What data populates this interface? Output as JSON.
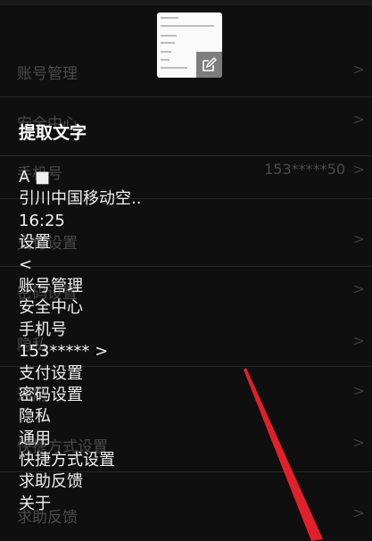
{
  "background": {
    "rows": [
      {
        "label": "账号管理",
        "value": ""
      },
      {
        "label": "安全中心",
        "value": ""
      },
      {
        "label": "手机号",
        "value": "153*****50"
      },
      {
        "label": "支付设置",
        "value": ""
      },
      {
        "label": "密码设置",
        "value": ""
      },
      {
        "label": "隐私",
        "value": ""
      },
      {
        "label": "通用",
        "value": ""
      },
      {
        "label": "快捷方式设置",
        "value": ""
      },
      {
        "label": "求助反馈",
        "value": ""
      }
    ]
  },
  "overlay": {
    "title": "提取文字",
    "lines": [
      "A ■",
      "引川中国移动空..",
      "16:25",
      "设置",
      "<",
      "账号管理",
      "安全中心",
      "手机号",
      "153***** >",
      "支付设置",
      "密码设置",
      "隐私",
      "通用",
      "快捷方式设置",
      "求助反馈",
      "关于"
    ]
  },
  "icons": {
    "edit": "edit-icon",
    "chevron": "chevron-right-icon",
    "arrow": "red-arrow-annotation"
  },
  "colors": {
    "background": "#0f0f0f",
    "text": "#f0f0f0",
    "arrow": "#e0202a"
  }
}
